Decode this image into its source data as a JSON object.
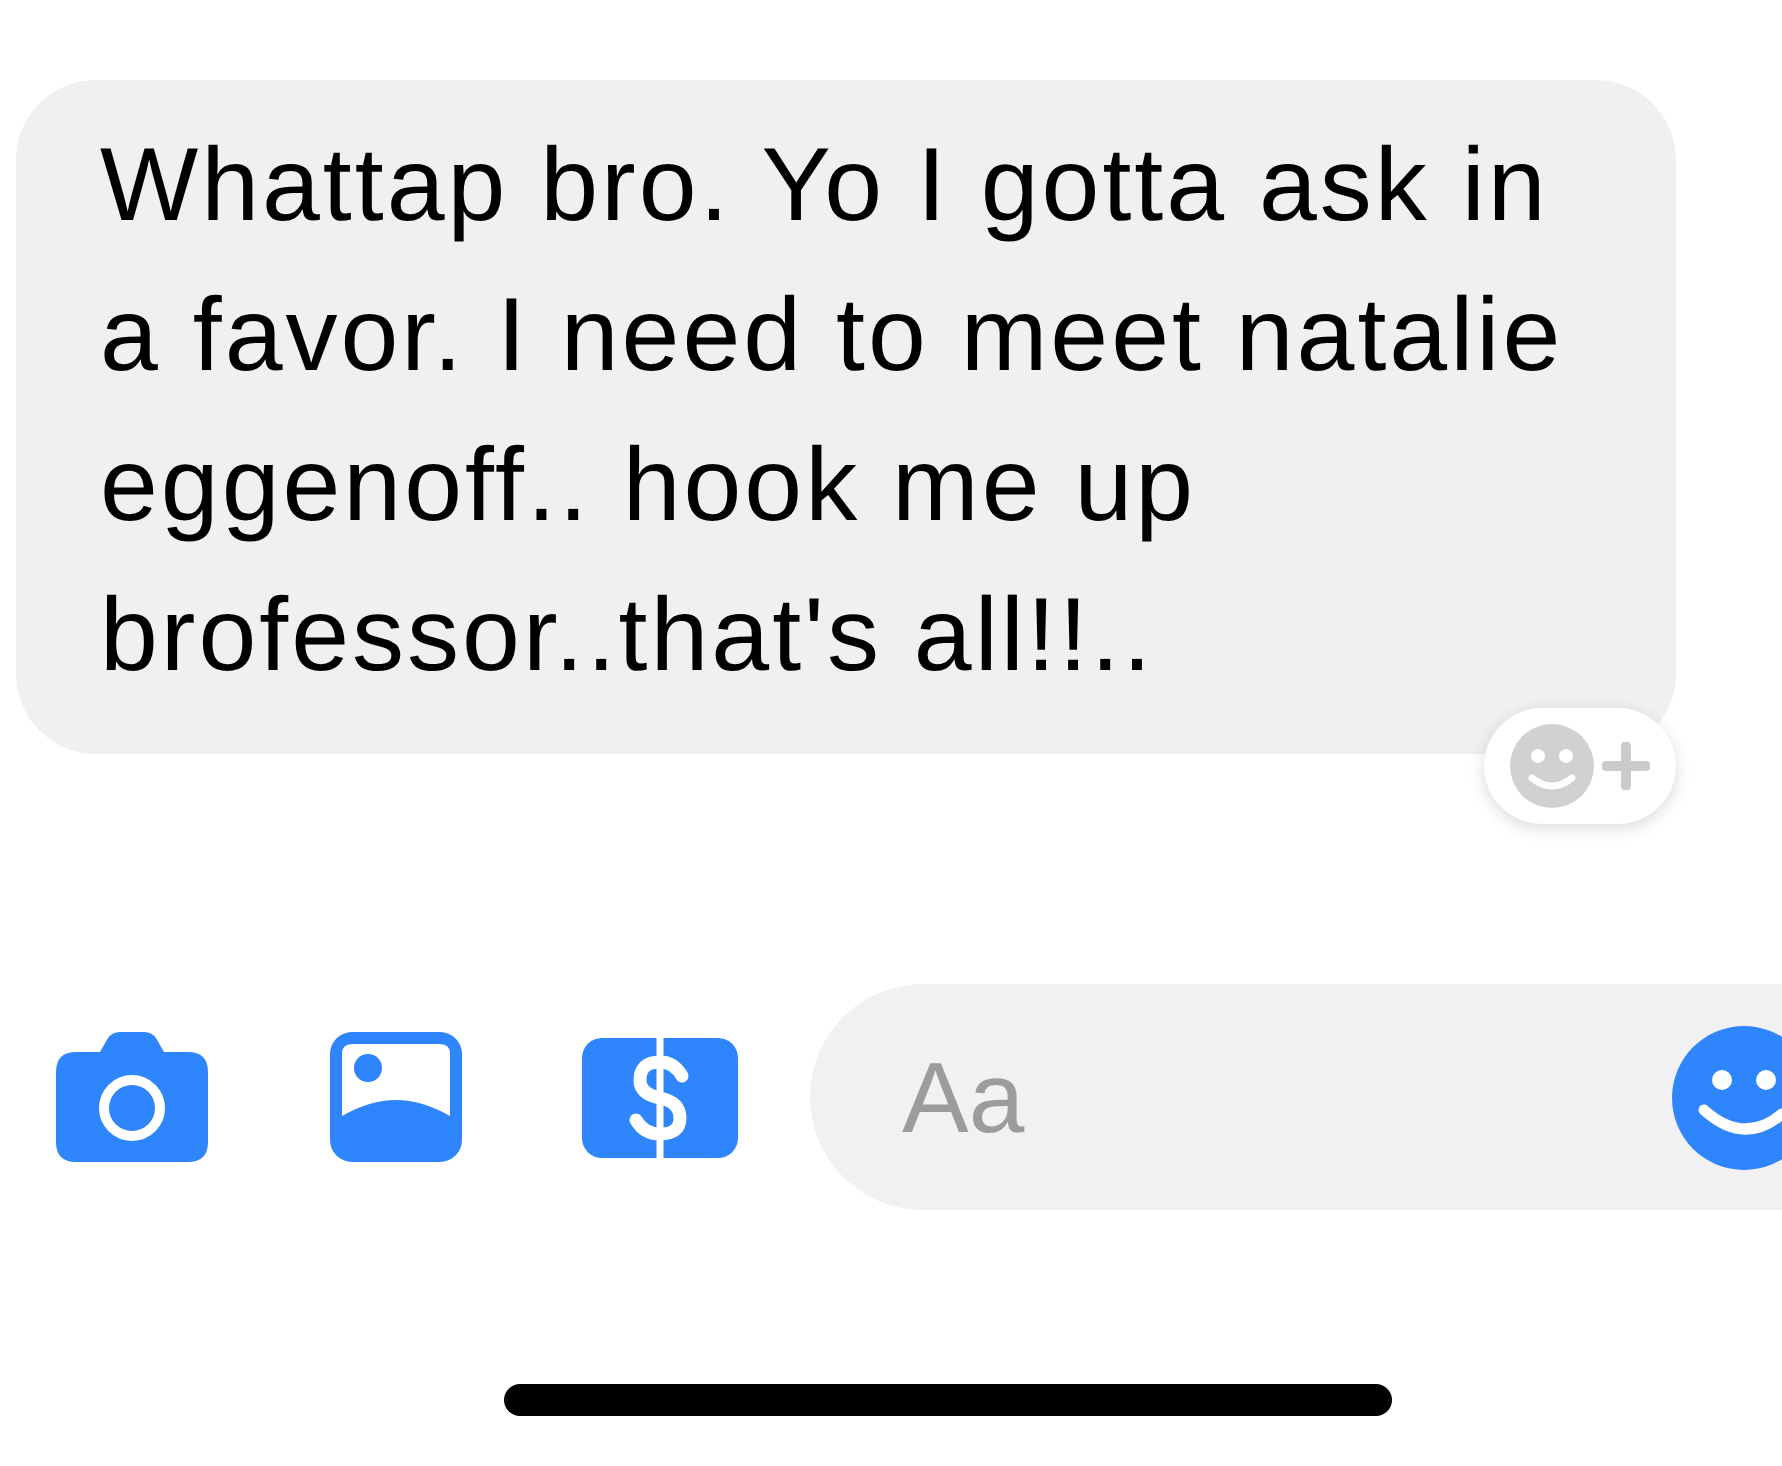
{
  "messages": [
    {
      "text": "Whattap bro. Yo I gotta ask in a favor. I need to meet natalie eggenoff.. hook me up brofessor..that's all!!.."
    }
  ],
  "composer": {
    "placeholder": "Aa"
  }
}
